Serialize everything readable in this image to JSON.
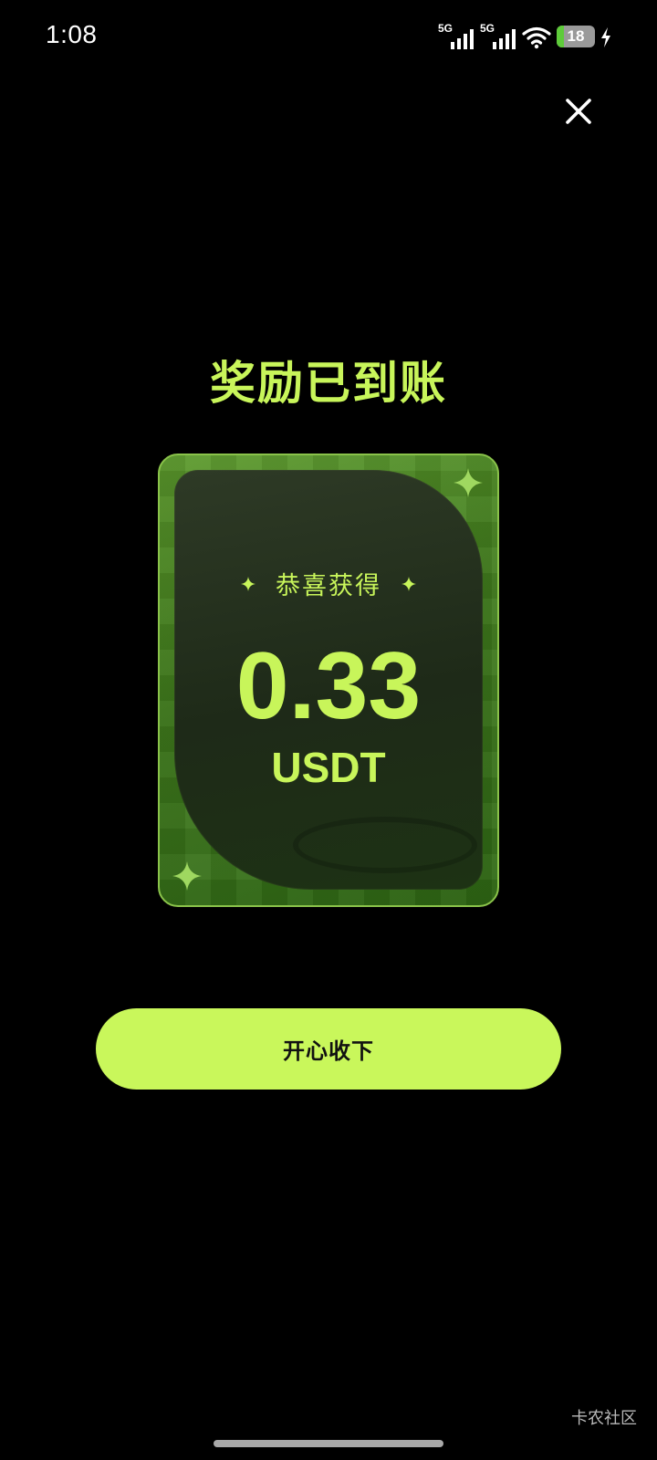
{
  "status_bar": {
    "time": "1:08",
    "sim1_network": "5G",
    "sim2_network": "5G",
    "battery_level": "18",
    "battery_fraction": 0.18,
    "charging": true
  },
  "dialog": {
    "close_icon": "close-icon",
    "title": "奖励已到账",
    "card": {
      "congrats_label": "恭喜获得",
      "amount": "0.33",
      "currency": "USDT"
    },
    "accept_button_label": "开心收下"
  },
  "watermark": "卡农社区",
  "colors": {
    "accent": "#c8f55a",
    "button": "#c9f75b",
    "background": "#000000",
    "card_green": "#3f7a1c"
  }
}
